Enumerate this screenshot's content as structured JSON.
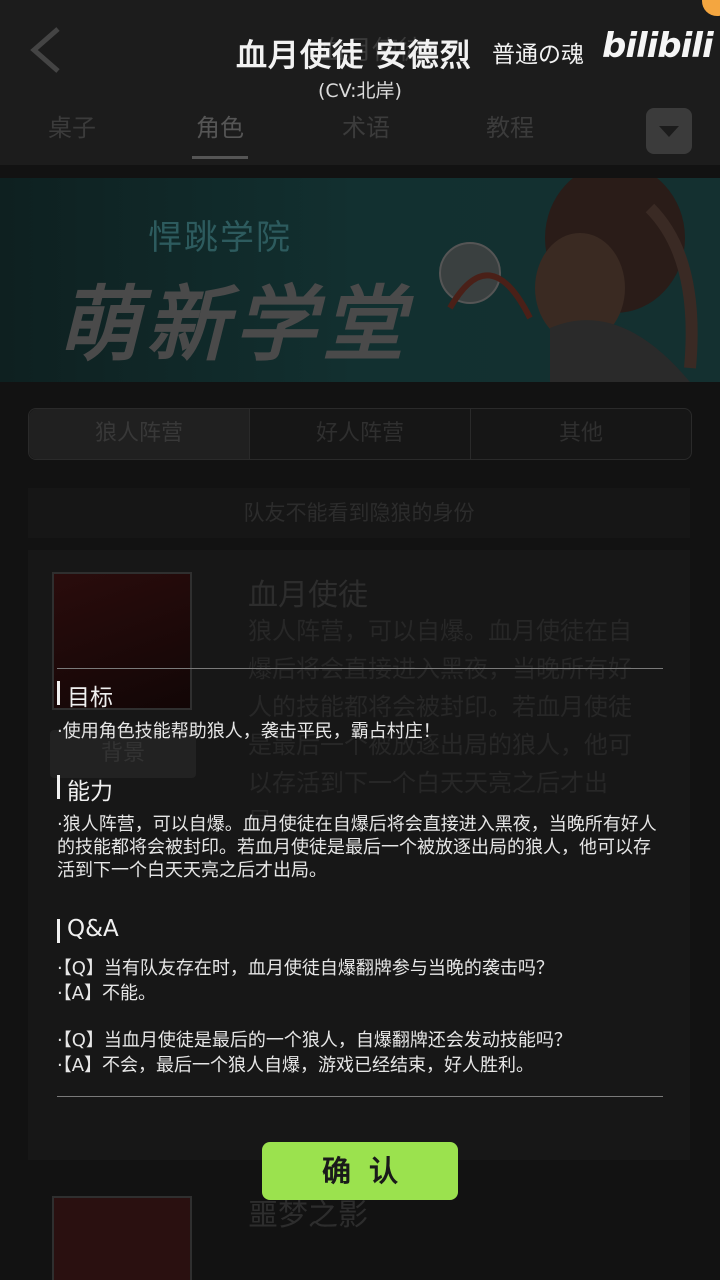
{
  "header": {
    "title_faded": "血月使徒",
    "tabs": [
      {
        "label": "桌子"
      },
      {
        "label": "角色"
      },
      {
        "label": "术语"
      },
      {
        "label": "教程"
      }
    ]
  },
  "banner": {
    "subtitle": "悍跳学院",
    "title": "萌新学堂"
  },
  "camp_tabs": [
    {
      "label": "狼人阵营"
    },
    {
      "label": "好人阵营"
    },
    {
      "label": "其他"
    }
  ],
  "notice": "队友不能看到隐狼的身份",
  "card": {
    "name": "血月使徒",
    "desc": "狼人阵营，可以自爆。血月使徒在自爆后将会直接进入黑夜，当晚所有好人的技能都将会被封印。若血月使徒是最后一个被放逐出局的狼人，他可以存活到下一个白天天亮之后才出局。",
    "button": "背景"
  },
  "card2": {
    "name": "噩梦之影"
  },
  "overlay": {
    "title": "血月使徒  安德烈",
    "cv": "(CV:北岸)",
    "watermark": "普通の魂",
    "logo": "bilibili"
  },
  "dialog": {
    "goal_title": "目标",
    "goal_text": "·使用角色技能帮助狼人，袭击平民，霸占村庄！",
    "ability_title": "能力",
    "ability_text": "·狼人阵营，可以自爆。血月使徒在自爆后将会直接进入黑夜，当晚所有好人的技能都将会被封印。若血月使徒是最后一个被放逐出局的狼人，他可以存活到下一个白天天亮之后才出局。",
    "qa_title": "Q&A",
    "qa": [
      {
        "q": "·【Q】当有队友存在时，血月使徒自爆翻牌参与当晚的袭击吗？",
        "a": "·【A】不能。"
      },
      {
        "q": "·【Q】当血月使徒是最后的一个狼人，自爆翻牌还会发动技能吗？",
        "a": "·【A】不会，最后一个狼人自爆，游戏已经结束，好人胜利。"
      }
    ],
    "confirm": "确认"
  },
  "colors": {
    "confirm_bg": "#9be24e",
    "overlay_text": "#f0f0f0"
  }
}
